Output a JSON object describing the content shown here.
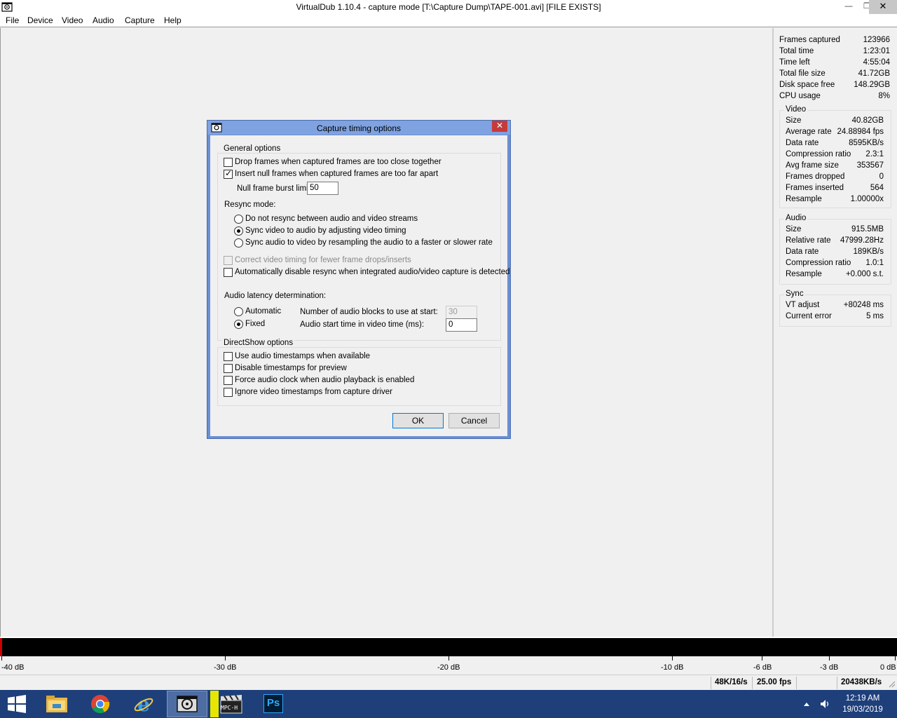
{
  "window": {
    "title": "VirtualDub 1.10.4 - capture mode [T:\\Capture Dump\\TAPE-001.avi] [FILE EXISTS]",
    "min_glyph": "—",
    "max_glyph": "❐",
    "close_glyph": "✕"
  },
  "menu": [
    "File",
    "Device",
    "Video",
    "Audio",
    "Capture",
    "Help"
  ],
  "stats": {
    "top": [
      {
        "label": "Frames captured",
        "value": "123966"
      },
      {
        "label": "Total time",
        "value": "1:23:01"
      },
      {
        "label": "Time left",
        "value": "4:55:04"
      },
      {
        "label": "Total file size",
        "value": "41.72GB"
      },
      {
        "label": "Disk space free",
        "value": "148.29GB"
      },
      {
        "label": "CPU usage",
        "value": "8%"
      }
    ],
    "video": {
      "title": "Video",
      "rows": [
        {
          "label": "Size",
          "value": "40.82GB"
        },
        {
          "label": "Average rate",
          "value": "24.88984 fps"
        },
        {
          "label": "Data rate",
          "value": "8595KB/s"
        },
        {
          "label": "Compression ratio",
          "value": "2.3:1"
        },
        {
          "label": "Avg frame size",
          "value": "353567"
        },
        {
          "label": "Frames dropped",
          "value": "0"
        },
        {
          "label": "Frames inserted",
          "value": "564"
        },
        {
          "label": "Resample",
          "value": "1.00000x"
        }
      ]
    },
    "audio": {
      "title": "Audio",
      "rows": [
        {
          "label": "Size",
          "value": "915.5MB"
        },
        {
          "label": "Relative rate",
          "value": "47999.28Hz"
        },
        {
          "label": "Data rate",
          "value": "189KB/s"
        },
        {
          "label": "Compression ratio",
          "value": "1.0:1"
        },
        {
          "label": "Resample",
          "value": "+0.000 s.t."
        }
      ]
    },
    "sync": {
      "title": "Sync",
      "rows": [
        {
          "label": "VT adjust",
          "value": "+80248 ms"
        },
        {
          "label": "Current error",
          "value": "5 ms"
        }
      ]
    }
  },
  "meter": {
    "labels": [
      "-40 dB",
      "-30 dB",
      "-20 dB",
      "-10 dB",
      "-6 dB",
      "-3 dB",
      "0 dB"
    ]
  },
  "statusbar": {
    "audio_format": "48K/16/s",
    "fps": "25.00 fps",
    "data_rate": "20438KB/s"
  },
  "dialog": {
    "title": "Capture timing options",
    "close_glyph": "✕",
    "general": {
      "legend": "General options",
      "drop_frames": {
        "label": "Drop frames when captured frames are too close together",
        "checked": false
      },
      "insert_null": {
        "label": "Insert null frames when captured frames are too far apart",
        "checked": true
      },
      "burst_label": "Null frame burst limit:",
      "burst_value": "50",
      "resync_label": "Resync mode:",
      "resync_options": [
        {
          "label": "Do not resync between audio and video streams",
          "checked": false
        },
        {
          "label": "Sync video to audio by adjusting video timing",
          "checked": true
        },
        {
          "label": "Sync audio to video by resampling the audio to a faster or slower rate",
          "checked": false
        }
      ],
      "correct_timing": {
        "label": "Correct video timing for fewer frame drops/inserts",
        "checked": false,
        "disabled": true
      },
      "auto_disable": {
        "label": "Automatically disable resync when integrated audio/video capture is detected",
        "checked": false
      },
      "latency_label": "Audio latency determination:",
      "latency_automatic": {
        "label": "Automatic",
        "checked": false
      },
      "latency_fixed": {
        "label": "Fixed",
        "checked": true
      },
      "blocks_label": "Number of audio blocks to use at start:",
      "blocks_value": "30",
      "start_time_label": "Audio start time in video time (ms):",
      "start_time_value": "0"
    },
    "directshow": {
      "legend": "DirectShow options",
      "options": [
        {
          "label": "Use audio timestamps when available",
          "checked": false
        },
        {
          "label": "Disable timestamps for preview",
          "checked": false
        },
        {
          "label": "Force audio clock when audio playback is enabled",
          "checked": false
        },
        {
          "label": "Ignore video timestamps from capture driver",
          "checked": false
        }
      ]
    },
    "ok_label": "OK",
    "cancel_label": "Cancel"
  },
  "taskbar": {
    "clock_time": "12:19 AM",
    "clock_date": "19/03/2019",
    "ps_label": "Ps",
    "mpc_label": "MPC·H"
  }
}
